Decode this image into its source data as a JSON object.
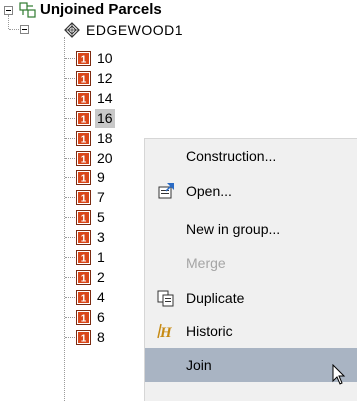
{
  "tree": {
    "root_label": "Unjoined Parcels",
    "group_label": "EDGEWOOD1",
    "parcels": [
      {
        "label": "10"
      },
      {
        "label": "12"
      },
      {
        "label": "14"
      },
      {
        "label": "16",
        "selected": true
      },
      {
        "label": "18"
      },
      {
        "label": "20"
      },
      {
        "label": "9"
      },
      {
        "label": "7"
      },
      {
        "label": "5"
      },
      {
        "label": "3"
      },
      {
        "label": "1"
      },
      {
        "label": "2"
      },
      {
        "label": "4"
      },
      {
        "label": "6"
      },
      {
        "label": "8"
      }
    ]
  },
  "context_menu": {
    "items": [
      {
        "label": "Construction...",
        "enabled": true,
        "icon": ""
      },
      {
        "label": "Open...",
        "enabled": true,
        "icon": "open-icon"
      },
      {
        "label": "New in group...",
        "enabled": true,
        "icon": ""
      },
      {
        "label": "Merge",
        "enabled": false,
        "icon": ""
      },
      {
        "label": "Duplicate",
        "enabled": true,
        "icon": "duplicate-icon"
      },
      {
        "label": "Historic",
        "enabled": true,
        "icon": "historic-icon"
      },
      {
        "label": "Join",
        "enabled": true,
        "icon": "",
        "highlighted": true
      }
    ]
  },
  "colors": {
    "parcel_icon": "#d9471a",
    "selection": "#c8c8c8",
    "menu_highlight": "#a9b4c3",
    "menu_background": "#f0f0f0"
  }
}
